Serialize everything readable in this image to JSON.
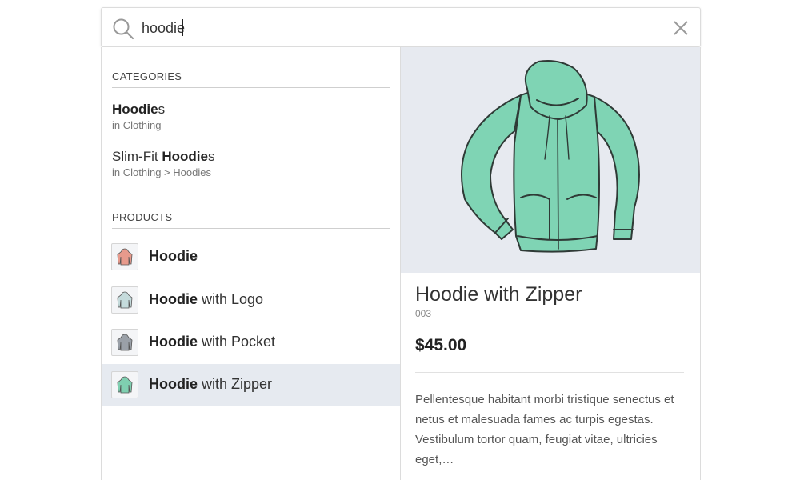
{
  "search": {
    "value": "hoodie",
    "placeholder": ""
  },
  "categories": {
    "title": "CATEGORIES",
    "items": [
      {
        "match": "Hoodie",
        "rest": "s",
        "prefix": "",
        "path": "in Clothing"
      },
      {
        "prefix": "Slim-Fit ",
        "match": "Hoodie",
        "rest": "s",
        "path": "in Clothing > Hoodies"
      }
    ]
  },
  "products": {
    "title": "PRODUCTS",
    "items": [
      {
        "match": "Hoodie",
        "rest": "",
        "thumb_color": "#e79a8c",
        "active": false
      },
      {
        "match": "Hoodie",
        "rest": " with Logo",
        "thumb_color": "#c5dbdc",
        "active": false
      },
      {
        "match": "Hoodie",
        "rest": " with Pocket",
        "thumb_color": "#9aa0a8",
        "active": false
      },
      {
        "match": "Hoodie",
        "rest": " with Zipper",
        "thumb_color": "#7fcfb0",
        "active": true
      }
    ]
  },
  "detail": {
    "title": "Hoodie with Zipper",
    "sku": "003",
    "price": "$45.00",
    "description": "Pellentesque habitant morbi tristique senectus et netus et malesuada fames ac turpis egestas. Vestibulum tortor quam, feugiat vitae, ultricies eget,…",
    "image_icon": "hoodie-zipper-illustration",
    "hoodie_color": "#7fd4b4"
  },
  "colors": {
    "active_row": "#e6eaf0",
    "preview_bg": "#e7eaf0"
  }
}
